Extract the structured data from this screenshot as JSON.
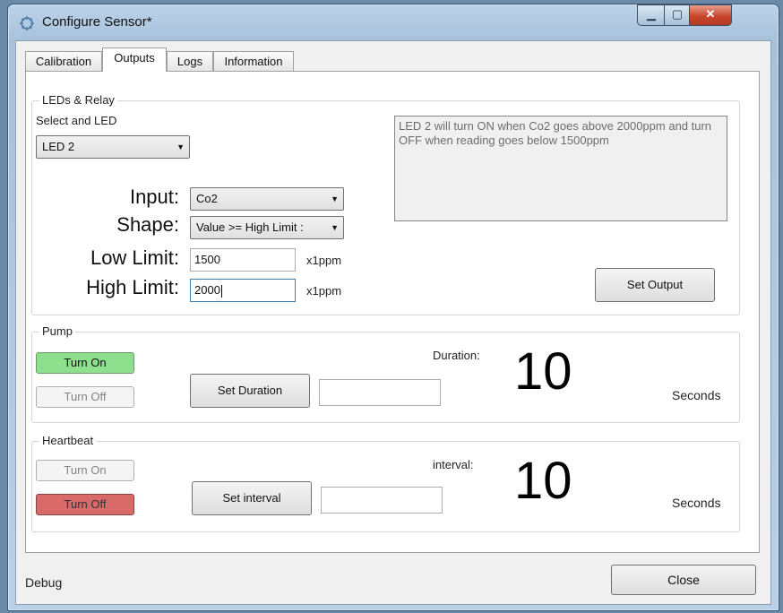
{
  "window": {
    "title": "Configure Sensor*"
  },
  "tabs": [
    {
      "label": "Calibration"
    },
    {
      "label": "Outputs"
    },
    {
      "label": "Logs"
    },
    {
      "label": "Information"
    }
  ],
  "leds": {
    "group_label": "LEDs & Relay",
    "select_label": "Select and LED",
    "selected_led": "LED 2",
    "input_label": "Input:",
    "input_value": "Co2",
    "shape_label": "Shape:",
    "shape_value": "Value >= High Limit :",
    "low_label": "Low Limit:",
    "low_value": "1500",
    "low_unit": "x1ppm",
    "high_label": "High Limit:",
    "high_value": "2000",
    "high_unit": "x1ppm",
    "description": "LED 2 will turn ON when Co2 goes above 2000ppm and turn OFF when reading goes below 1500ppm",
    "set_output": "Set Output"
  },
  "pump": {
    "group_label": "Pump",
    "turn_on": "Turn On",
    "turn_off": "Turn Off",
    "set_duration": "Set Duration",
    "duration_label": "Duration:",
    "duration_value": "10",
    "unit": "Seconds"
  },
  "heartbeat": {
    "group_label": "Heartbeat",
    "turn_on": "Turn On",
    "turn_off": "Turn Off",
    "set_interval": "Set interval",
    "interval_label": "interval:",
    "interval_value": "10",
    "unit": "Seconds"
  },
  "footer": {
    "debug": "Debug",
    "close": "Close"
  },
  "colors": {
    "on_green": "#8ee08e",
    "off_red": "#d86a6a"
  }
}
